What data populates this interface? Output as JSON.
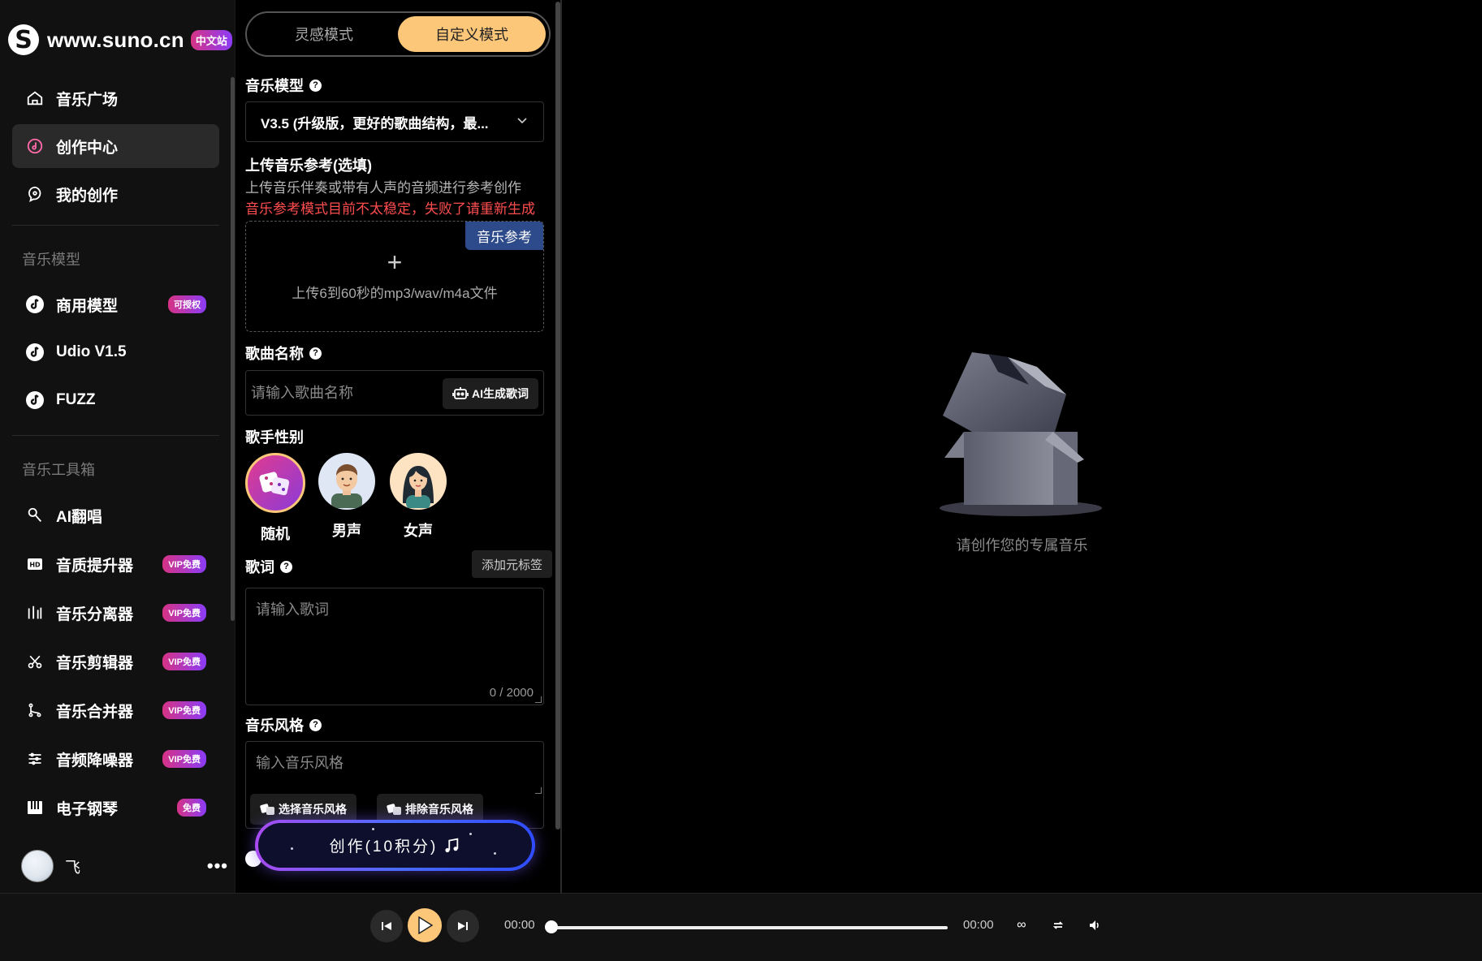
{
  "brand": {
    "name": "www.suno.cn",
    "badge": "中文站",
    "logo_glyph": "S"
  },
  "sidebar": {
    "nav": [
      {
        "label": "音乐广场",
        "icon": "home-icon"
      },
      {
        "label": "创作中心",
        "icon": "create-music-icon",
        "active": true
      },
      {
        "label": "我的创作",
        "icon": "my-works-icon"
      }
    ],
    "models_title": "音乐模型",
    "models": [
      {
        "label": "商用模型",
        "badge": "可授权",
        "icon": "music-note-icon"
      },
      {
        "label": "Udio V1.5",
        "badge": "",
        "icon": "music-note-icon"
      },
      {
        "label": "FUZZ",
        "badge": "",
        "icon": "music-note-icon"
      }
    ],
    "tools_title": "音乐工具箱",
    "tools": [
      {
        "label": "AI翻唱",
        "badge": "",
        "icon": "microphone-icon"
      },
      {
        "label": "音质提升器",
        "badge": "VIP免费",
        "icon": "hd-icon"
      },
      {
        "label": "音乐分离器",
        "badge": "VIP免费",
        "icon": "split-icon"
      },
      {
        "label": "音乐剪辑器",
        "badge": "VIP免费",
        "icon": "scissors-icon"
      },
      {
        "label": "音乐合并器",
        "badge": "VIP免费",
        "icon": "merge-icon"
      },
      {
        "label": "音频降噪器",
        "badge": "VIP免费",
        "icon": "sliders-icon"
      },
      {
        "label": "电子钢琴",
        "badge": "免费",
        "icon": "piano-icon"
      }
    ],
    "user": {
      "name": "飞",
      "more": "•••"
    }
  },
  "panel": {
    "modes": [
      {
        "label": "灵感模式"
      },
      {
        "label": "自定义模式",
        "active": true
      }
    ],
    "model": {
      "label": "音乐模型",
      "selected": "V3.5 (升级版，更好的歌曲结构，最..."
    },
    "upload": {
      "label": "上传音乐参考(选填)",
      "desc": "上传音乐伴奏或带有人声的音频进行参考创作",
      "warn": "音乐参考模式目前不太稳定，失败了请重新生成",
      "tag": "音乐参考",
      "plus": "+",
      "text": "上传6到60秒的mp3/wav/m4a文件"
    },
    "song_name": {
      "label": "歌曲名称",
      "placeholder": "请输入歌曲名称",
      "ai_button": "AI生成歌词"
    },
    "gender": {
      "label": "歌手性别",
      "options": [
        {
          "label": "随机",
          "selected": true
        },
        {
          "label": "男声"
        },
        {
          "label": "女声"
        }
      ]
    },
    "lyrics": {
      "label": "歌词",
      "tag_button": "添加元标签",
      "placeholder": "请输入歌词",
      "counter": "0 / 2000"
    },
    "style": {
      "label": "音乐风格",
      "placeholder": "输入音乐风格",
      "select_button": "选择音乐风格",
      "exclude_button": "排除音乐风格"
    },
    "create_button": "创作(10积分)"
  },
  "main": {
    "empty_text": "请创作您的专属音乐"
  },
  "player": {
    "current_time": "00:00",
    "total_time": "00:00",
    "progress": 0
  },
  "colors": {
    "accent": "#fcc779",
    "badge_from": "#d63384",
    "badge_to": "#8b3cf7",
    "warn": "#ff4d4f",
    "tag_blue": "#2d4a8a"
  }
}
